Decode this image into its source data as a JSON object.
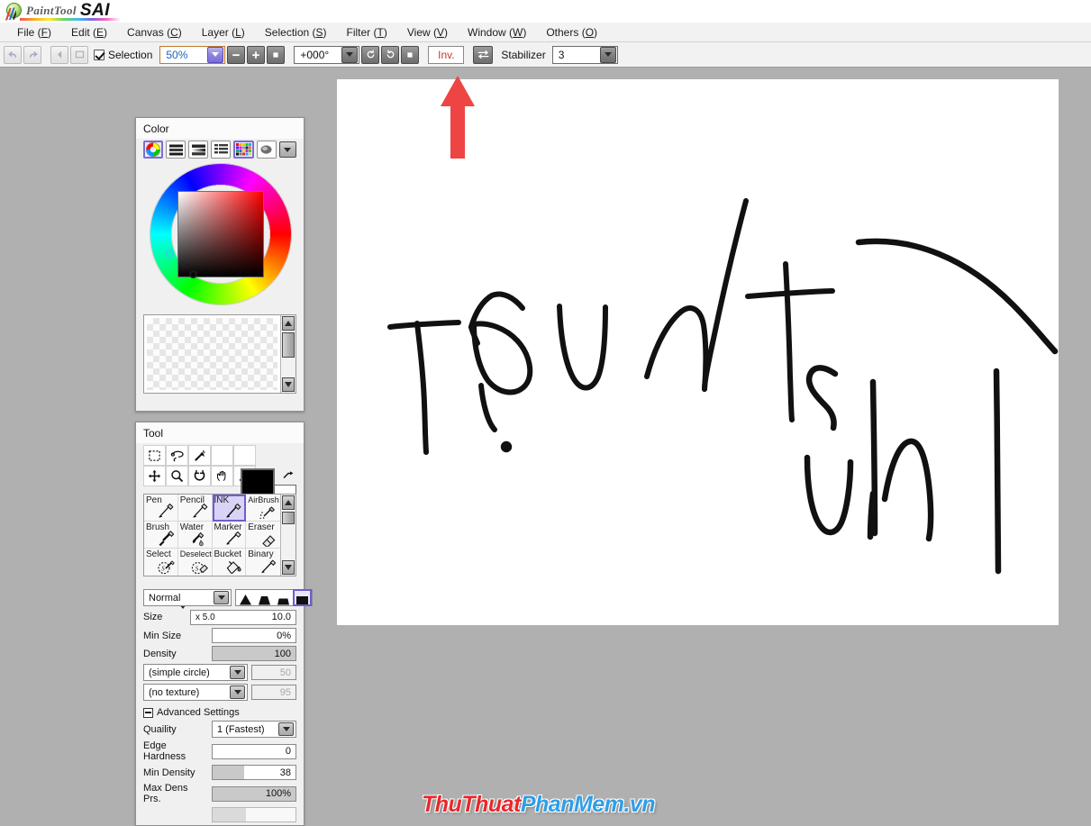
{
  "app": {
    "brand_paint": "PaintTool",
    "brand_sai": "SAI",
    "logo_icon": "sai-leaf-logo"
  },
  "menubar": {
    "items": [
      {
        "label": "File",
        "accel": "F"
      },
      {
        "label": "Edit",
        "accel": "E"
      },
      {
        "label": "Canvas",
        "accel": "C"
      },
      {
        "label": "Layer",
        "accel": "L"
      },
      {
        "label": "Selection",
        "accel": "S"
      },
      {
        "label": "Filter",
        "accel": "T"
      },
      {
        "label": "View",
        "accel": "V"
      },
      {
        "label": "Window",
        "accel": "W"
      },
      {
        "label": "Others",
        "accel": "O"
      }
    ]
  },
  "toolbar": {
    "undo_icon": "undo-arrow-icon",
    "redo_icon": "redo-arrow-icon",
    "prev_icon": "previous-layer-icon",
    "next_icon": "next-layer-icon",
    "selection_label": "Selection",
    "selection_checked": true,
    "zoom_value": "50%",
    "zoom_out_icon": "minus-icon",
    "zoom_in_icon": "plus-icon",
    "zoom_reset_icon": "square-icon",
    "rotation_value": "+000°",
    "rotate_ccw_icon": "rotate-ccw-icon",
    "rotate_cw_icon": "rotate-cw-icon",
    "rotate_reset_icon": "square-icon",
    "invert_label": "Inv.",
    "flip_icon": "flip-horizontal-icon",
    "stabilizer_label": "Stabilizer",
    "stabilizer_value": "3"
  },
  "annotation": {
    "arrow_icon": "red-up-arrow-annotation",
    "color": "#ef4444"
  },
  "color_panel": {
    "title": "Color",
    "modes": [
      {
        "name": "color-wheel-mode",
        "selected": true
      },
      {
        "name": "rgb-slider-mode",
        "selected": false
      },
      {
        "name": "hsv-slider-mode",
        "selected": false
      },
      {
        "name": "color-list-mode",
        "selected": false
      },
      {
        "name": "palette-grid-mode",
        "selected": true
      },
      {
        "name": "scratchpad-mode",
        "selected": false
      }
    ],
    "menu_icon": "chevron-down-icon",
    "current_hue_color": "#ff0000",
    "selected_color": "#000000",
    "swatch_area_name": "empty-swatch-tray"
  },
  "tool_panel": {
    "title": "Tool",
    "quick_tools": [
      {
        "name": "rect-select-icon",
        "label": "Rectangle Select"
      },
      {
        "name": "lasso-select-icon",
        "label": "Lasso"
      },
      {
        "name": "magic-wand-icon",
        "label": "Magic Wand"
      },
      {
        "name": "empty-slot-1",
        "label": ""
      },
      {
        "name": "empty-slot-2",
        "label": ""
      },
      {
        "name": "move-icon",
        "label": "Move"
      },
      {
        "name": "zoom-icon",
        "label": "Zoom"
      },
      {
        "name": "rotate-icon",
        "label": "Rotate"
      },
      {
        "name": "hand-icon",
        "label": "Hand"
      },
      {
        "name": "eyedropper-icon",
        "label": "Eyedropper"
      }
    ],
    "foreground_color": "#000000",
    "background_color": "#ffffff",
    "swap_icon": "swap-colors-icon",
    "transparent_icon": "transparent-color-icon",
    "brushes": [
      {
        "label": "Pen",
        "icon": "pen-icon",
        "selected": false
      },
      {
        "label": "Pencil",
        "icon": "pencil-icon",
        "selected": false
      },
      {
        "label": "INK",
        "icon": "ink-pen-icon",
        "selected": true
      },
      {
        "label": "AirBrush",
        "icon": "airbrush-icon",
        "selected": false
      },
      {
        "label": "Brush",
        "icon": "brush-icon",
        "selected": false
      },
      {
        "label": "Water",
        "icon": "watercolor-icon",
        "selected": false
      },
      {
        "label": "Marker",
        "icon": "marker-icon",
        "selected": false
      },
      {
        "label": "Eraser",
        "icon": "eraser-icon",
        "selected": false
      },
      {
        "label": "Select",
        "icon": "select-pen-icon",
        "selected": false
      },
      {
        "label": "Deselect",
        "icon": "deselect-eraser-icon",
        "selected": false
      },
      {
        "label": "Bucket",
        "icon": "bucket-icon",
        "selected": false
      },
      {
        "label": "Binary",
        "icon": "binary-pen-icon",
        "selected": false
      }
    ],
    "blend_mode": "Normal",
    "edge_shapes": [
      {
        "name": "soft-edge-shape",
        "selected": false
      },
      {
        "name": "medium-edge-shape",
        "selected": false
      },
      {
        "name": "firm-edge-shape",
        "selected": false
      },
      {
        "name": "hard-edge-shape",
        "selected": true
      }
    ],
    "settings": {
      "size_label": "Size",
      "size_multiplier": "x 5.0",
      "size_value": "10.0",
      "min_size_label": "Min Size",
      "min_size_value": "0%",
      "min_size_percent": 0,
      "density_label": "Density",
      "density_value": "100",
      "density_percent": 100,
      "shape_label": "(simple circle)",
      "shape_value": "50",
      "texture_label": "(no texture)",
      "texture_value": "95"
    },
    "advanced": {
      "title": "Advanced Settings",
      "quality_label": "Quaility",
      "quality_value": "1 (Fastest)",
      "edge_hardness_label": "Edge Hardness",
      "edge_hardness_value": "0",
      "edge_hardness_percent": 0,
      "min_density_label": "Min Density",
      "min_density_value": "38",
      "min_density_percent": 38,
      "max_dens_prs_label": "Max Dens Prs.",
      "max_dens_prs_value": "100%",
      "max_dens_prs_percent": 100
    }
  },
  "canvas": {
    "name": "drawing-canvas",
    "background": "#ffffff",
    "strokes_description": "handwritten ink strokes"
  },
  "watermark": {
    "part_red": "ThuThuat",
    "part_blue": "PhanMem.vn",
    "color_red": "#e8282c",
    "color_blue": "#2f9ee8"
  }
}
